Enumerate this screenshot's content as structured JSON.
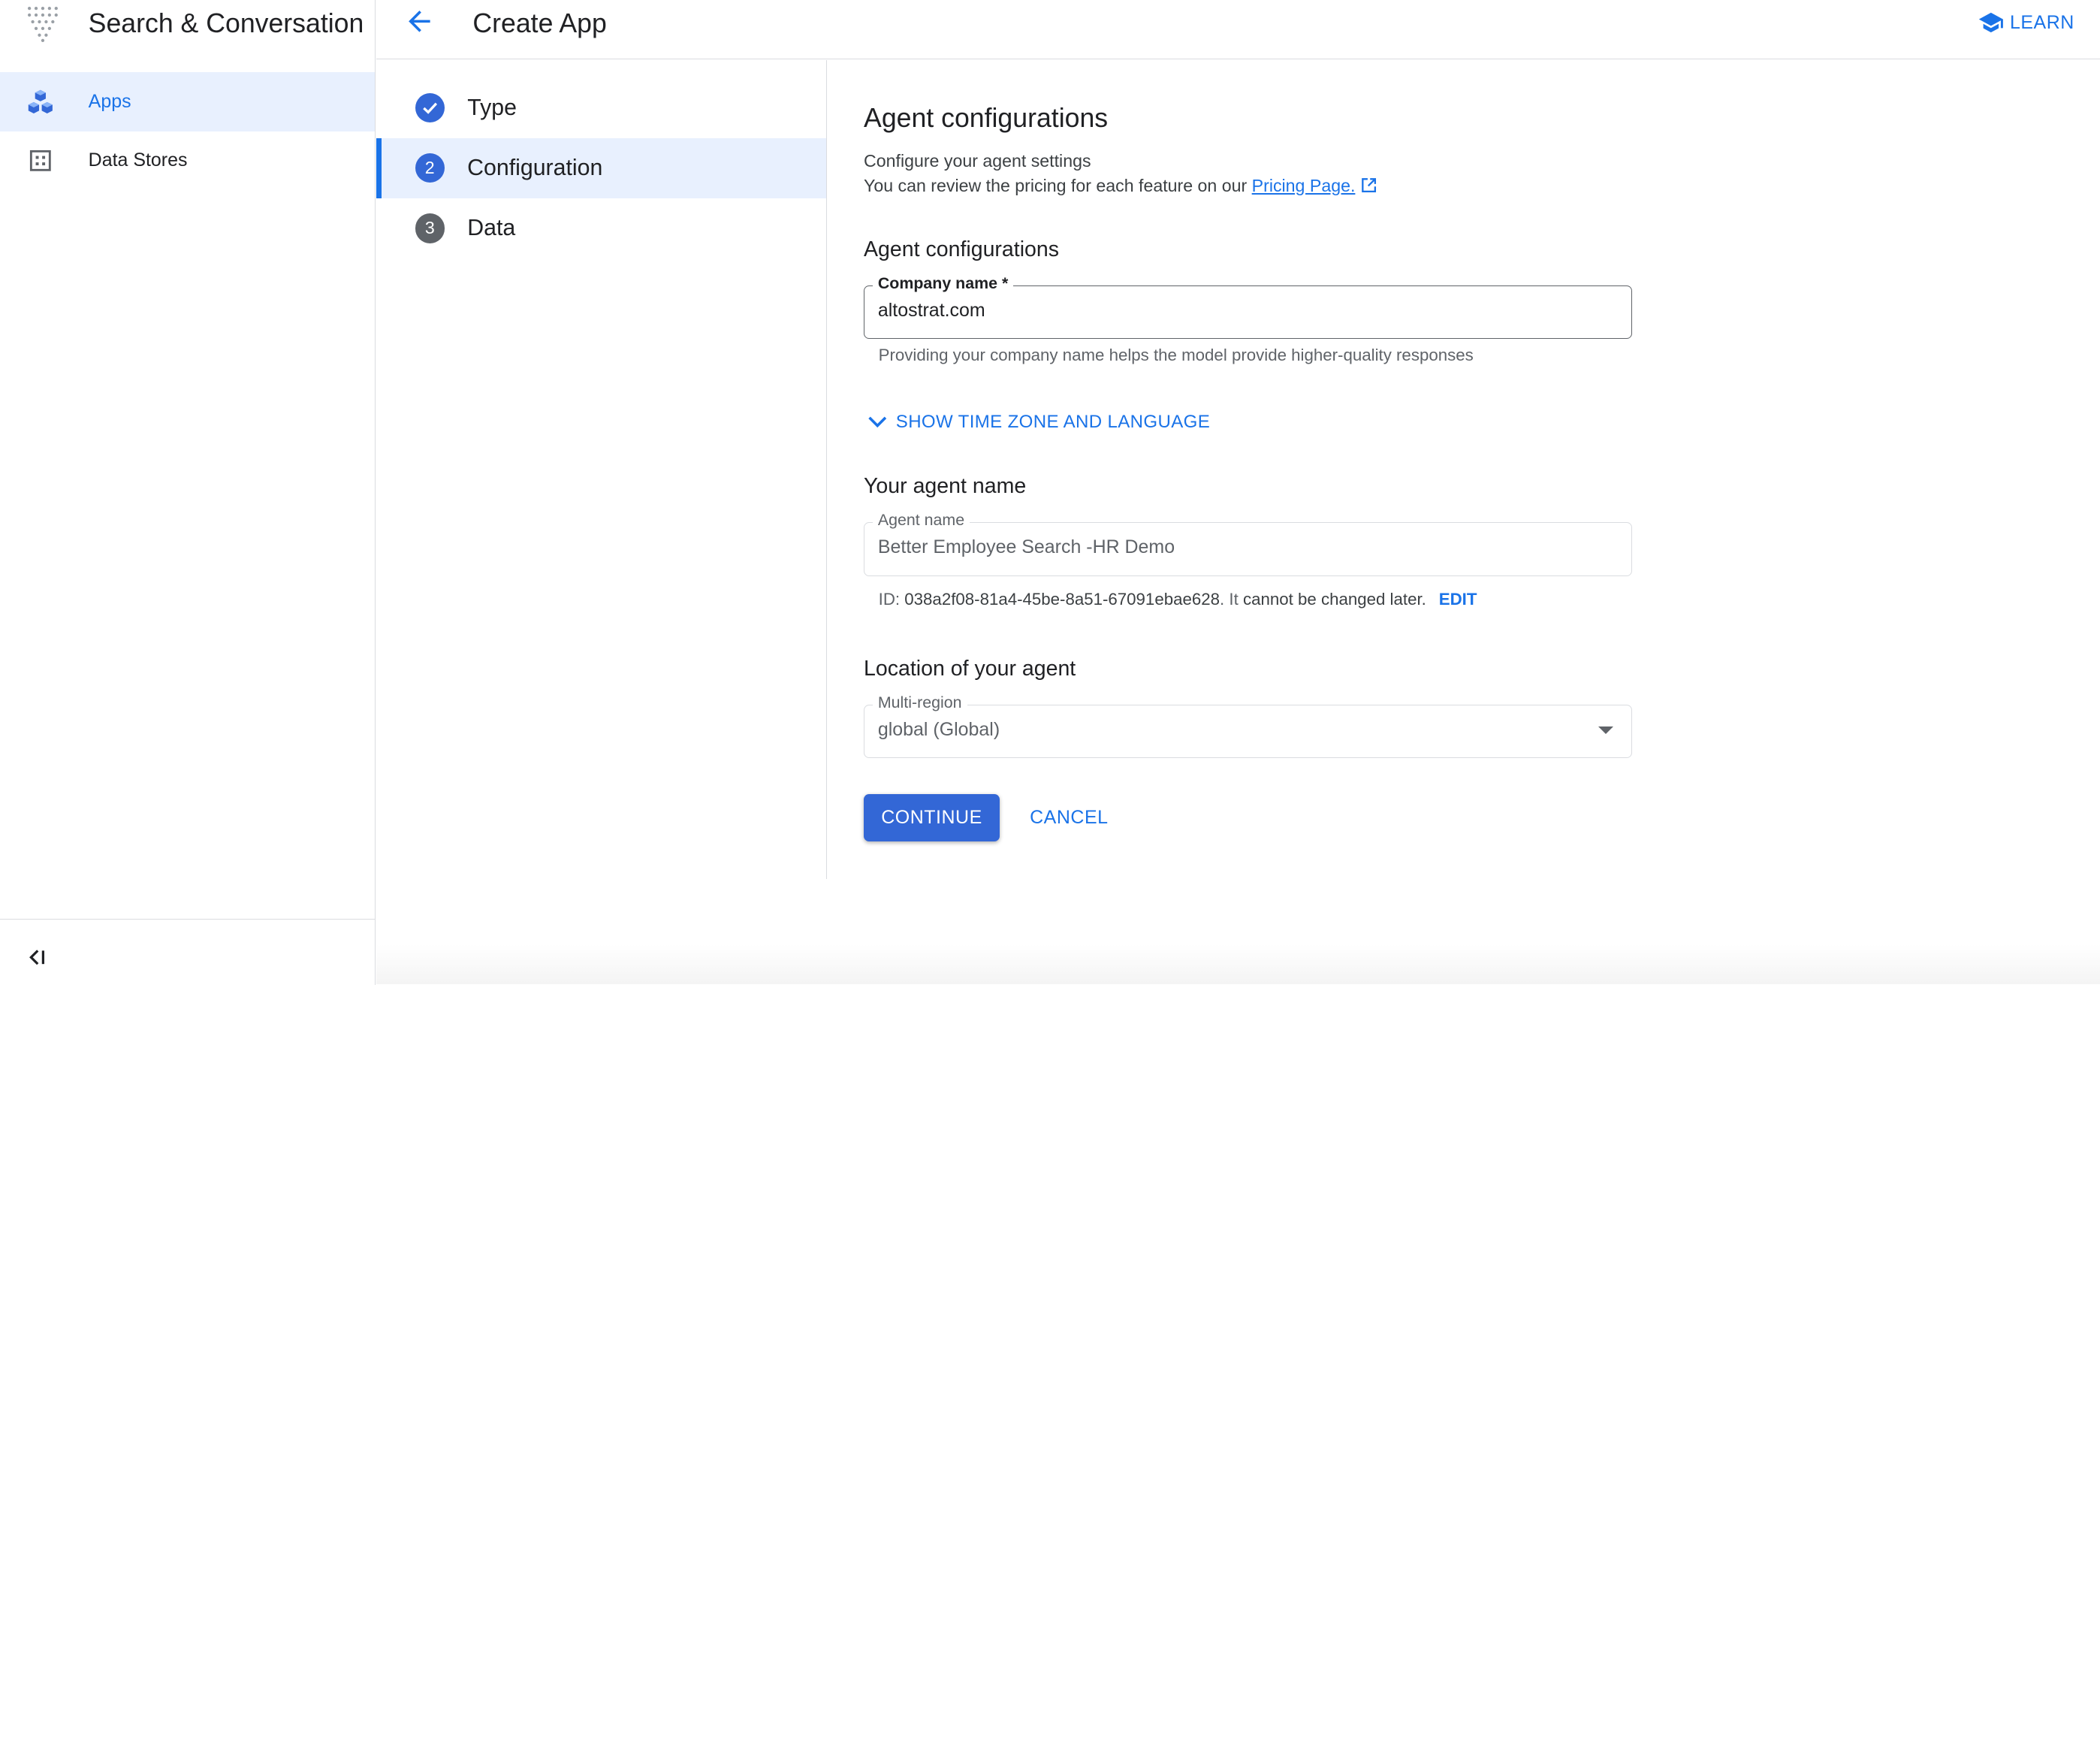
{
  "app": {
    "title": "Search & Conversation"
  },
  "sidebar": {
    "items": [
      {
        "label": "Apps",
        "icon": "apps-cubes-icon",
        "active": true
      },
      {
        "label": "Data Stores",
        "icon": "data-stores-icon",
        "active": false
      }
    ],
    "collapse_icon": "collapse-sidebar-icon"
  },
  "header": {
    "title": "Create App",
    "back_icon": "arrow-back-icon",
    "learn_label": "LEARN",
    "learn_icon": "school-icon"
  },
  "stepper": {
    "steps": [
      {
        "number": "",
        "label": "Type",
        "state": "done"
      },
      {
        "number": "2",
        "label": "Configuration",
        "state": "active"
      },
      {
        "number": "3",
        "label": "Data",
        "state": "upcoming"
      }
    ]
  },
  "form": {
    "heading": "Agent configurations",
    "subtitle": "Configure your agent settings",
    "pricing_text": "You can review the pricing for each feature on our",
    "pricing_link": "Pricing Page.",
    "section_agent_config": "Agent configurations",
    "company_name": {
      "label": "Company name *",
      "value": "altostrat.com",
      "hint": "Providing your company name helps the model provide higher-quality responses"
    },
    "show_tz_label": "SHOW TIME ZONE AND LANGUAGE",
    "section_agent_name": "Your agent name",
    "agent_name": {
      "label": "Agent name",
      "value": "Better Employee Search -HR Demo"
    },
    "id_prefix": "ID:",
    "id_value": "038a2f08-81a4-45be-8a51-67091ebae628",
    "id_suffix_plain": ". It",
    "id_suffix_bold": "cannot be changed later.",
    "edit_label": "EDIT",
    "section_location": "Location of your agent",
    "location": {
      "label": "Multi-region",
      "value": "global (Global)"
    },
    "continue_label": "CONTINUE",
    "cancel_label": "CANCEL"
  },
  "colors": {
    "accent": "#1a73e8",
    "primary_button": "#3367d6",
    "active_bg": "#e8f0fe",
    "step_done": "#3367d6",
    "step_inactive": "#5f6368"
  }
}
